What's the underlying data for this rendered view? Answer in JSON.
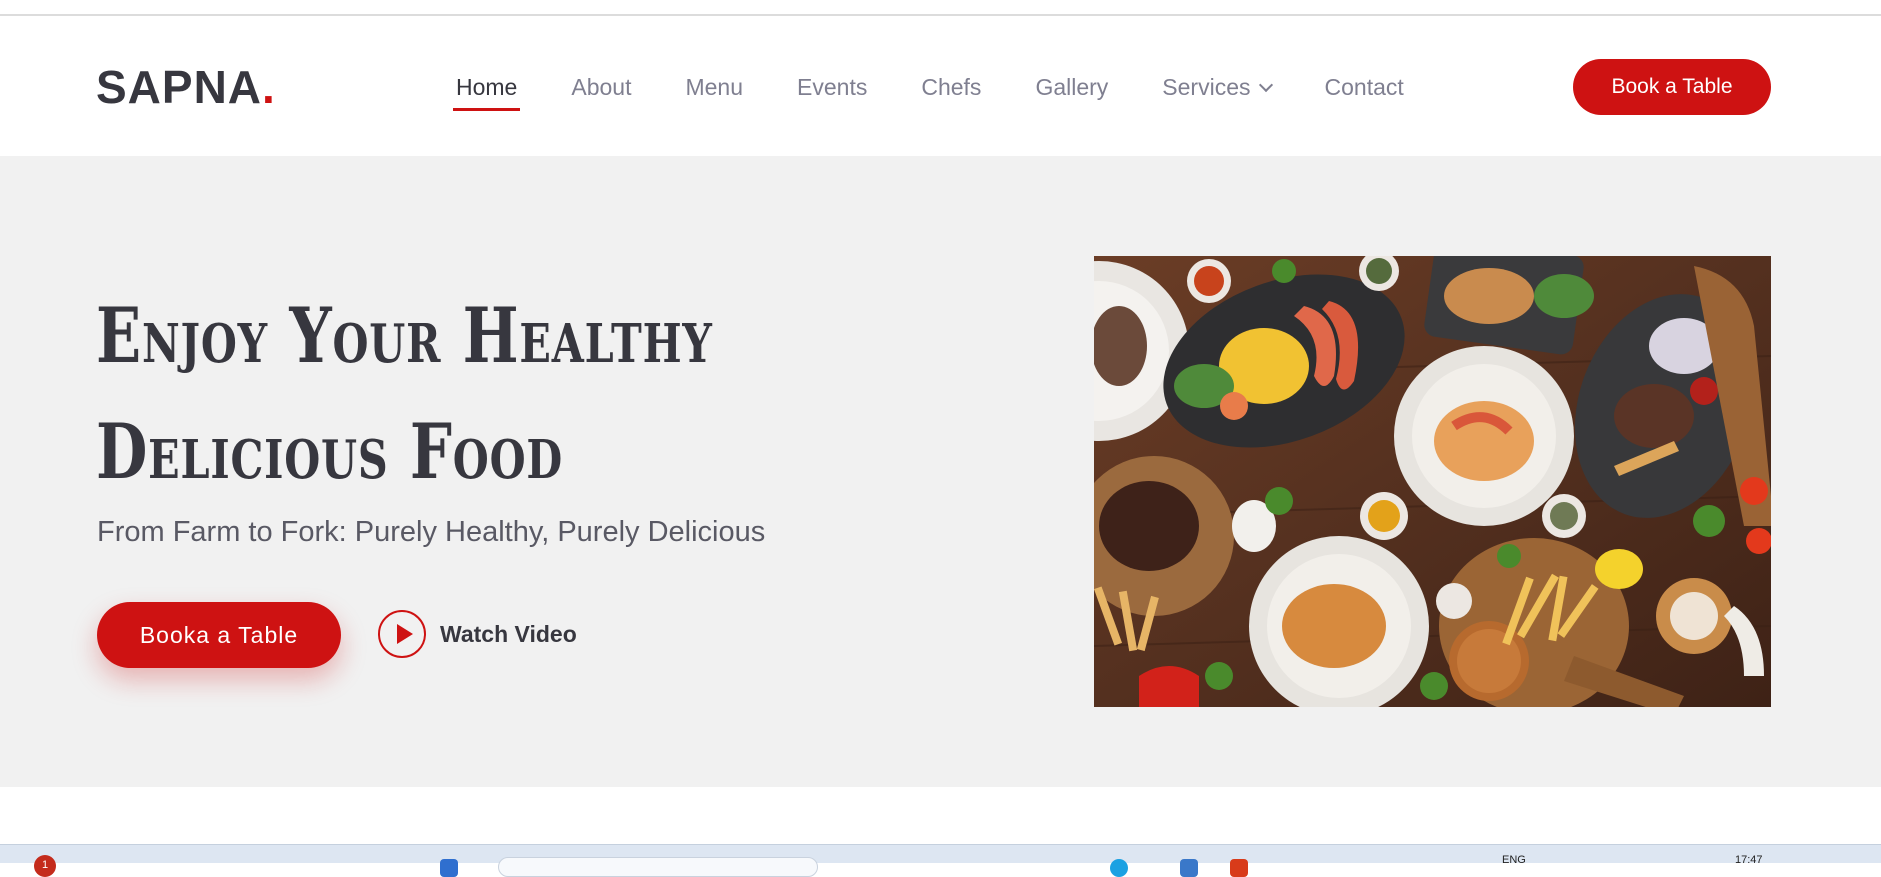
{
  "header": {
    "logo": "SAPNA",
    "logo_dot": ".",
    "nav": [
      {
        "label": "Home"
      },
      {
        "label": "About"
      },
      {
        "label": "Menu"
      },
      {
        "label": "Events"
      },
      {
        "label": "Chefs"
      },
      {
        "label": "Gallery"
      },
      {
        "label": "Services"
      },
      {
        "label": "Contact"
      }
    ],
    "book_button": "Book a Table"
  },
  "hero": {
    "title_line1": "Enjoy Your Healthy",
    "title_line2": "Delicious Food",
    "subtitle": "From Farm to Fork: Purely Healthy, Purely Delicious",
    "book_button": "Booka a Table",
    "watch_label": "Watch Video"
  },
  "taskbar": {
    "badge": "1",
    "lang": "ENG",
    "time": "17:47"
  },
  "colors": {
    "accent": "#ce1212",
    "text": "#37373f",
    "hero_bg": "#f1f1f1"
  },
  "icons": [
    "chevron-down-icon",
    "play-icon"
  ]
}
